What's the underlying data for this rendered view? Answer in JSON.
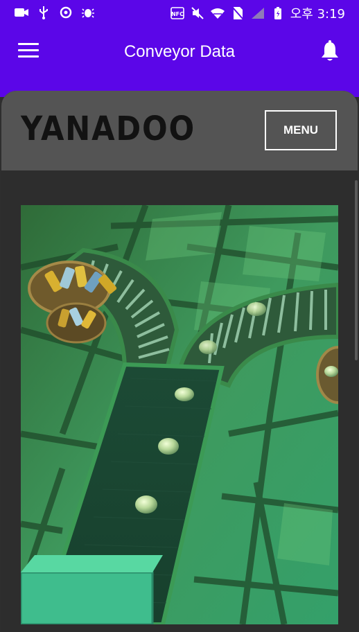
{
  "status_bar": {
    "time": "오후 3:19",
    "icons": [
      "video-icon",
      "usb-icon",
      "sync-icon",
      "bug-icon",
      "nfc-icon",
      "mute-icon",
      "wifi-icon",
      "no-sim-icon",
      "signal-icon",
      "battery-icon"
    ]
  },
  "app_bar": {
    "title": "Conveyor Data",
    "menu_icon": "hamburger-icon",
    "notification_icon": "bell-icon"
  },
  "card": {
    "logo": "YANADOO",
    "menu_label": "MENU"
  },
  "scene": {
    "description_icon": "conveyor-scene-image"
  },
  "colors": {
    "app_bar": "#5b06e8",
    "card_header": "#545454",
    "background": "#2e2e2e"
  }
}
